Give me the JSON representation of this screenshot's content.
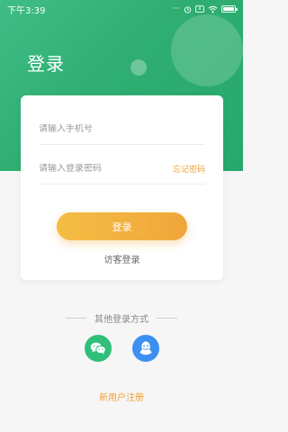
{
  "status_bar": {
    "time": "下午3:39",
    "icons": [
      "more-icon",
      "alarm-icon",
      "sim-icon",
      "wifi-icon",
      "battery-icon"
    ]
  },
  "header": {
    "title": "登录"
  },
  "form": {
    "phone_placeholder": "请输入手机号",
    "password_placeholder": "请输入登录密码",
    "forgot_label": "忘记密码",
    "login_label": "登录",
    "guest_label": "访客登录"
  },
  "other_login": {
    "label": "其他登录方式",
    "providers": [
      "wechat-icon",
      "qq-icon"
    ]
  },
  "register_label": "新用户注册",
  "colors": {
    "green": "#2fae72",
    "orange": "#f0a63a",
    "wechat": "#2fbf78",
    "qq": "#3d8ff0",
    "background": "#f6f6f6"
  }
}
